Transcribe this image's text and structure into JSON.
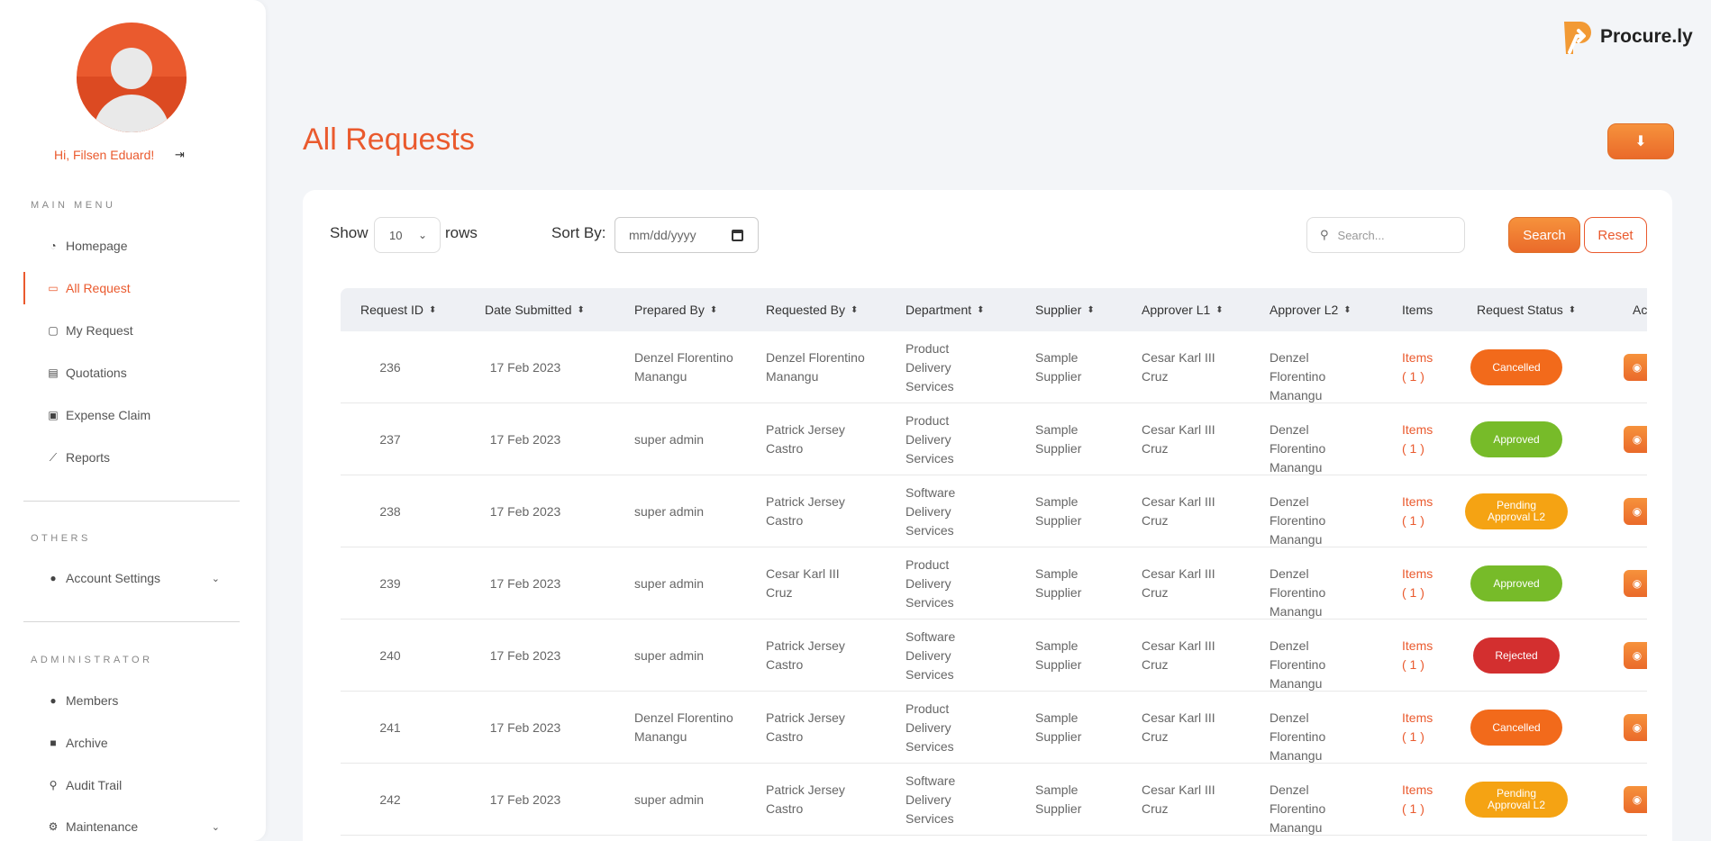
{
  "user": {
    "greeting": "Hi, Filsen Eduard!"
  },
  "sidebar": {
    "main_menu_label": "MAIN MENU",
    "main_items": [
      {
        "label": "Homepage",
        "icon": "dashboard-icon"
      },
      {
        "label": "All Request",
        "icon": "chat-bubble-icon",
        "active": true
      },
      {
        "label": "My Request",
        "icon": "note-icon"
      },
      {
        "label": "Quotations",
        "icon": "newspaper-icon"
      },
      {
        "label": "Expense Claim",
        "icon": "money-icon"
      },
      {
        "label": "Reports",
        "icon": "chart-line-icon"
      }
    ],
    "others_label": "OTHERS",
    "account_settings": "Account Settings",
    "administrator_label": "ADMINISTRATOR",
    "admin_items": [
      {
        "label": "Members",
        "icon": "users-icon"
      },
      {
        "label": "Archive",
        "icon": "archive-icon"
      },
      {
        "label": "Audit Trail",
        "icon": "search-icon"
      },
      {
        "label": "Maintenance",
        "icon": "cogs-icon"
      }
    ]
  },
  "brand": {
    "name": "Procure.ly"
  },
  "page": {
    "title": "All Requests"
  },
  "controls": {
    "show_label": "Show",
    "rows_value": "10",
    "rows_label": "rows",
    "sort_label": "Sort By:",
    "date_placeholder": "mm/dd/yyyy",
    "search_placeholder": "Search...",
    "search_button": "Search",
    "reset_button": "Reset"
  },
  "table": {
    "headers": [
      "Request ID",
      "Date Submitted",
      "Prepared By",
      "Requested By",
      "Department",
      "Supplier",
      "Approver L1",
      "Approver L2",
      "Items",
      "Request Status",
      "Ac"
    ],
    "rows": [
      {
        "id": "236",
        "date": "17 Feb 2023",
        "prepared_by": "Denzel Florentino Manangu",
        "requested_by": "Denzel Florentino Manangu",
        "department": "Product Delivery Services",
        "supplier": "Sample Supplier",
        "approver_l1": "Cesar Karl III Cruz",
        "approver_l2": "Denzel Florentino Manangu",
        "items": "Items",
        "items_count": "( 1 )",
        "status": "Cancelled"
      },
      {
        "id": "237",
        "date": "17 Feb 2023",
        "prepared_by": "super admin",
        "requested_by": "Patrick Jersey Castro",
        "department": "Product Delivery Services",
        "supplier": "Sample Supplier",
        "approver_l1": "Cesar Karl III Cruz",
        "approver_l2": "Denzel Florentino Manangu",
        "items": "Items",
        "items_count": "( 1 )",
        "status": "Approved"
      },
      {
        "id": "238",
        "date": "17 Feb 2023",
        "prepared_by": "super admin",
        "requested_by": "Patrick Jersey Castro",
        "department": "Software Delivery Services",
        "supplier": "Sample Supplier",
        "approver_l1": "Cesar Karl III Cruz",
        "approver_l2": "Denzel Florentino Manangu",
        "items": "Items",
        "items_count": "( 1 )",
        "status": "Pending Approval L2"
      },
      {
        "id": "239",
        "date": "17 Feb 2023",
        "prepared_by": "super admin",
        "requested_by": "Cesar Karl III Cruz",
        "department": "Product Delivery Services",
        "supplier": "Sample Supplier",
        "approver_l1": "Cesar Karl III Cruz",
        "approver_l2": "Denzel Florentino Manangu",
        "items": "Items",
        "items_count": "( 1 )",
        "status": "Approved"
      },
      {
        "id": "240",
        "date": "17 Feb 2023",
        "prepared_by": "super admin",
        "requested_by": "Patrick Jersey Castro",
        "department": "Software Delivery Services",
        "supplier": "Sample Supplier",
        "approver_l1": "Cesar Karl III Cruz",
        "approver_l2": "Denzel Florentino Manangu",
        "items": "Items",
        "items_count": "( 1 )",
        "status": "Rejected"
      },
      {
        "id": "241",
        "date": "17 Feb 2023",
        "prepared_by": "Denzel Florentino Manangu",
        "requested_by": "Patrick Jersey Castro",
        "department": "Product Delivery Services",
        "supplier": "Sample Supplier",
        "approver_l1": "Cesar Karl III Cruz",
        "approver_l2": "Denzel Florentino Manangu",
        "items": "Items",
        "items_count": "( 1 )",
        "status": "Cancelled"
      },
      {
        "id": "242",
        "date": "17 Feb 2023",
        "prepared_by": "super admin",
        "requested_by": "Patrick Jersey Castro",
        "department": "Software Delivery Services",
        "supplier": "Sample Supplier",
        "approver_l1": "Cesar Karl III Cruz",
        "approver_l2": "Denzel Florentino Manangu",
        "items": "Items",
        "items_count": "( 1 )",
        "status": "Pending Approval L2"
      }
    ]
  },
  "status_colors": {
    "Cancelled": "#f26a1b",
    "Approved": "#77bb29",
    "Pending Approval L2": "#f5a313",
    "Rejected": "#d32f2f"
  },
  "colors": {
    "accent": "#ea5a2e"
  }
}
